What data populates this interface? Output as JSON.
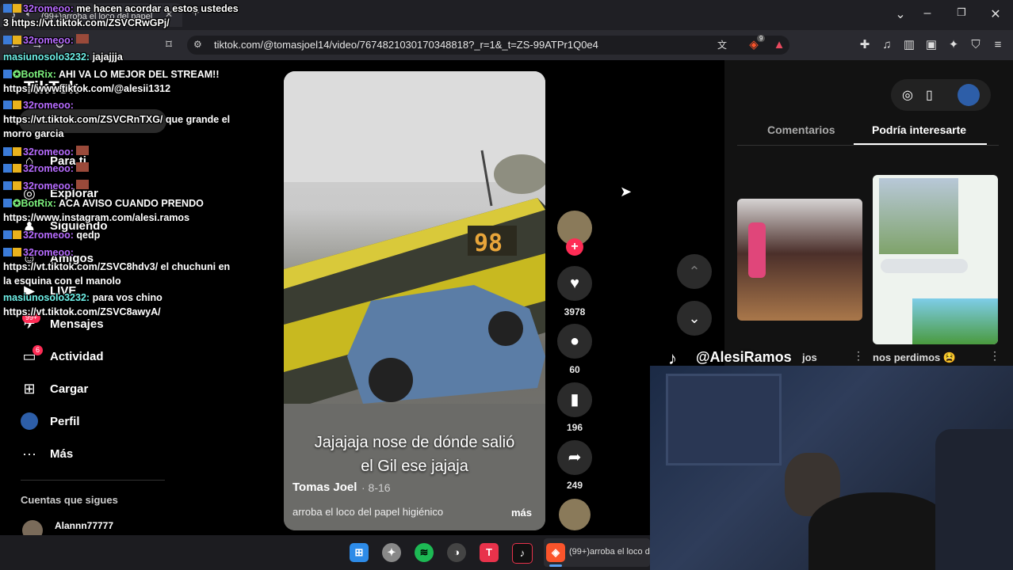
{
  "browser": {
    "tab_title": "(99+)arroba el loco del papel",
    "url": "tiktok.com/@tomasjoel14/video/7674821030170348818?_r=1&_t=ZS-99ATPr1Q0e4",
    "brave_badge": "9"
  },
  "sidebar": {
    "logo": "TikTok",
    "items": [
      {
        "label": "Para ti",
        "icon": "home-icon"
      },
      {
        "label": "Explorar",
        "icon": "compass-icon"
      },
      {
        "label": "Siguiendo",
        "icon": "following-icon"
      },
      {
        "label": "Amigos",
        "icon": "friends-icon"
      },
      {
        "label": "LIVE",
        "icon": "live-icon"
      },
      {
        "label": "Mensajes",
        "icon": "message-icon",
        "badge": "99+"
      },
      {
        "label": "Actividad",
        "icon": "activity-icon",
        "badge": "6"
      },
      {
        "label": "Cargar",
        "icon": "upload-icon"
      },
      {
        "label": "Perfil",
        "icon": "profile-icon"
      },
      {
        "label": "Más",
        "icon": "more-icon"
      }
    ],
    "following_title": "Cuentas que sigues",
    "following_user": "Alannn77777"
  },
  "chat": [
    {
      "user": "32romeoo:",
      "text": "me hacen acordar a estos ustedes 3 https://vt.tiktok.com/ZSVCRwGPj/",
      "color": "purple"
    },
    {
      "user": "32romeoo:",
      "text": "",
      "color": "purple"
    },
    {
      "user": "masiunosolo3232:",
      "text": "jajajjja",
      "color": "cyan"
    },
    {
      "user": "BotRix:",
      "text": "AHI VA LO MEJOR DEL STREAM!! https://www.tiktok.com/@alesii1312",
      "color": "green"
    },
    {
      "user": "32romeoo:",
      "text": "https://vt.tiktok.com/ZSVCRnTXG/ que grande el morro garcia",
      "color": "purple"
    },
    {
      "user": "32romeoo:",
      "text": "",
      "color": "purple"
    },
    {
      "user": "32romeoo:",
      "text": "",
      "color": "purple"
    },
    {
      "user": "32romeoo:",
      "text": "",
      "color": "purple"
    },
    {
      "user": "BotRix:",
      "text": "ACA AVISO CUANDO PRENDO https://www.instagram.com/alesi.ramos",
      "color": "green"
    },
    {
      "user": "32romeoo:",
      "text": "qedp",
      "color": "purple"
    },
    {
      "user": "32romeoo:",
      "text": "https://vt.tiktok.com/ZSVC8hdv3/ el chuchuni en la esquina con el manolo",
      "color": "purple"
    },
    {
      "user": "masiunosolo3232:",
      "text": "para vos chino https://vt.tiktok.com/ZSVC8awyA/",
      "color": "cyan"
    }
  ],
  "video": {
    "caption_line1": "Jajajaja nose de dónde salió",
    "caption_line2": "el Gil ese jajaja",
    "author": "Tomas Joel",
    "date": "· 8-16",
    "description": "arroba el loco del papel higiénico",
    "more": "más",
    "bus_number": "98",
    "likes": "3978",
    "comments": "60",
    "saves": "196",
    "shares": "249"
  },
  "right_panel": {
    "tabs": [
      "Comentarios",
      "Podría interesarte"
    ],
    "active_tab": "Podría interesarte",
    "card1_title": "jos",
    "card2_title": "nos perdimos 😫"
  },
  "stream_overlay": {
    "handle": "@AlesiRamos"
  },
  "taskbar": {
    "active_title": "(99+)arroba el loco d"
  },
  "colors": {
    "accent": "#fe2c55",
    "chat_purple": "#b76bff",
    "chat_cyan": "#6ef0e8",
    "chat_green": "#7cf07c"
  }
}
